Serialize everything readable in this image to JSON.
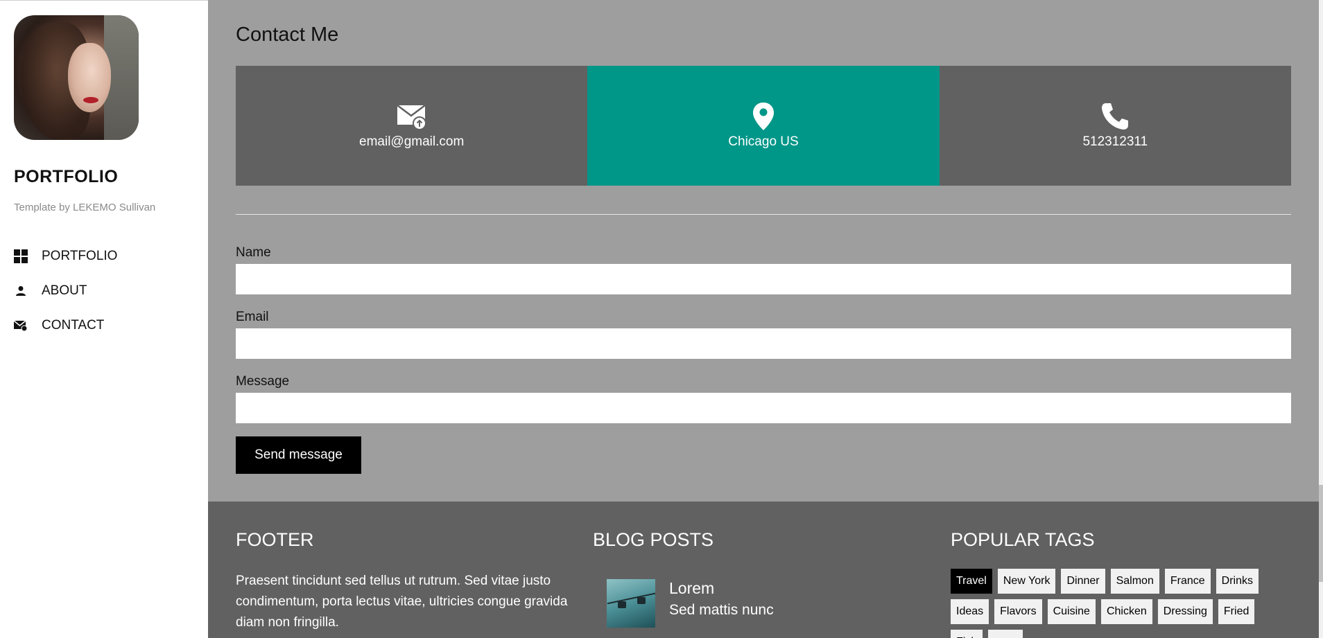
{
  "sidebar": {
    "brand": "PORTFOLIO",
    "subtitle": "Template by LEKEMO Sullivan",
    "nav": [
      {
        "label": "PORTFOLIO",
        "icon": "grid-icon"
      },
      {
        "label": "ABOUT",
        "icon": "user-icon"
      },
      {
        "label": "CONTACT",
        "icon": "envelope-icon"
      }
    ]
  },
  "contact": {
    "title": "Contact Me",
    "cards": [
      {
        "text": "email@gmail.com",
        "icon": "envelope-upload-icon",
        "color": "#616161"
      },
      {
        "text": "Chicago US",
        "icon": "map-pin-icon",
        "color": "#009688"
      },
      {
        "text": "512312311",
        "icon": "phone-icon",
        "color": "#616161"
      }
    ],
    "form": {
      "name_label": "Name",
      "name_value": "",
      "email_label": "Email",
      "email_value": "",
      "message_label": "Message",
      "message_value": "",
      "send_label": "Send message"
    }
  },
  "footer": {
    "title": "FOOTER",
    "text": "Praesent tincidunt sed tellus ut rutrum. Sed vitae justo condimentum, porta lectus vitae, ultricies congue gravida diam non fringilla.",
    "blog_title": "BLOG POSTS",
    "post": {
      "title": "Lorem",
      "subtitle": "Sed mattis nunc"
    },
    "tags_title": "POPULAR TAGS",
    "tags": [
      "Travel",
      "New York",
      "Dinner",
      "Salmon",
      "France",
      "Drinks",
      "Ideas",
      "Flavors",
      "Cuisine",
      "Chicken",
      "Dressing",
      "Fried",
      "Fish",
      ""
    ],
    "active_tag": "Travel"
  },
  "colors": {
    "main_bg": "#9e9e9e",
    "card_gray": "#616161",
    "card_teal": "#009688",
    "footer_bg": "#616161"
  }
}
